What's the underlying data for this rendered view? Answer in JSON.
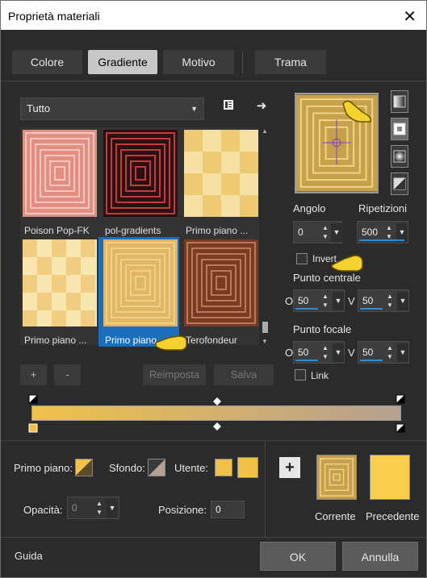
{
  "window": {
    "title": "Proprietà materiali",
    "close_glyph": "✕"
  },
  "tabs": [
    {
      "label": "Colore"
    },
    {
      "label": "Gradiente"
    },
    {
      "label": "Motivo"
    },
    {
      "label": "Trama"
    }
  ],
  "category": {
    "selected": "Tutto"
  },
  "gallery": [
    {
      "label": "Poison Pop-FK"
    },
    {
      "label": "pol-gradients"
    },
    {
      "label": "Primo piano ..."
    },
    {
      "label": "Primo piano ..."
    },
    {
      "label": "Primo piano ..."
    },
    {
      "label": "Terofondeur"
    }
  ],
  "lib_buttons": {
    "add": "+",
    "remove": "-",
    "reset": "Reimposta",
    "save": "Salva"
  },
  "params": {
    "angle_label": "Angolo",
    "angle": "0",
    "repeat_label": "Ripetizioni",
    "repeat": "500",
    "invert_label": "Inverti",
    "center_label": "Punto centrale",
    "center_h_prefix": "O",
    "center_h": "50",
    "center_v_prefix": "V",
    "center_v": "50",
    "focal_label": "Punto focale",
    "focal_h_prefix": "O",
    "focal_h": "50",
    "focal_v_prefix": "V",
    "focal_v": "50",
    "link_label": "Link"
  },
  "materials": {
    "fg_label": "Primo piano:",
    "bg_label": "Sfondo:",
    "user_label": "Utente:",
    "opacity_label": "Opacità:",
    "opacity": "0",
    "position_label": "Posizione:",
    "position": "0",
    "current_label": "Corrente",
    "previous_label": "Precedente"
  },
  "footer": {
    "help": "Guida",
    "ok": "OK",
    "cancel": "Annulla"
  },
  "colors": {
    "gold": "#f0c14a",
    "taupe": "#b5a092",
    "accent": "#1b6fba",
    "bg": "#2b2b2b"
  }
}
